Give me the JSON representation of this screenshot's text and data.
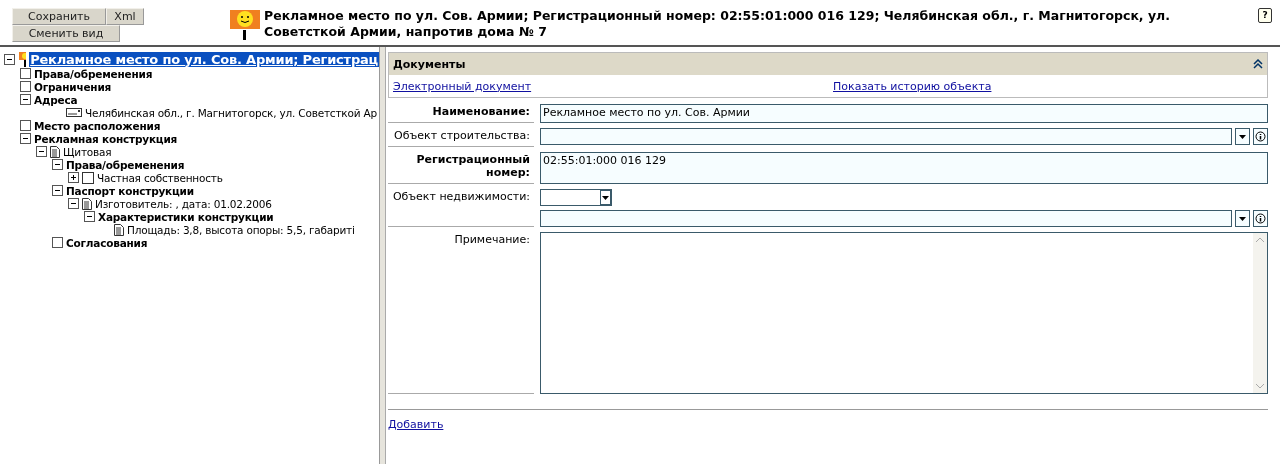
{
  "toolbar": {
    "buttons": [
      {
        "label": "Сохранить"
      },
      {
        "label": "Xml"
      },
      {
        "label": "Сменить вид"
      }
    ]
  },
  "header": {
    "title": "Рекламное место по ул. Сов. Армии; Регистрационный номер: 02:55:01:000 016 129; Челябинская обл., г. Магнитогорск, ул. Советсткой Армии, напротив дома № 7",
    "help": "?"
  },
  "tree": [
    {
      "kind": "root",
      "label": "Рекламное место по ул. Сов. Армии; Регистрац",
      "expanded": true,
      "selected": true,
      "children": [
        {
          "kind": "section",
          "label": "Права/обременения",
          "selected": false
        },
        {
          "kind": "section",
          "label": "Ограничения",
          "selected": false
        },
        {
          "kind": "section",
          "label": "Адреса",
          "expanded": true,
          "selected": false,
          "children": [
            {
              "kind": "address",
              "label": "Челябинская обл., г. Магнитогорск, ул. Советсткой Ар",
              "selected": false
            }
          ]
        },
        {
          "kind": "section",
          "label": "Место расположения",
          "selected": false
        },
        {
          "kind": "section",
          "label": "Рекламная конструкция",
          "expanded": true,
          "selected": false,
          "children": [
            {
              "kind": "document",
              "label": "Щитовая",
              "expanded": true,
              "selected": false,
              "children": [
                {
                  "kind": "section",
                  "label": "Права/обременения",
                  "expanded": true,
                  "selected": false,
                  "children": [
                    {
                      "kind": "record",
                      "label": "Частная собственность",
                      "expanded": false,
                      "selected": false
                    }
                  ]
                },
                {
                  "kind": "section",
                  "label": "Паспорт конструкции",
                  "expanded": true,
                  "selected": false,
                  "children": [
                    {
                      "kind": "document",
                      "label": "Изготовитель: , дата: 01.02.2006",
                      "expanded": true,
                      "selected": false,
                      "children": [
                        {
                          "kind": "section",
                          "label": "Характеристики конструкции",
                          "expanded": true,
                          "selected": false,
                          "children": [
                            {
                              "kind": "document",
                              "label": "Площадь: 3,8, высота опоры: 5,5, габариті",
                              "selected": false
                            }
                          ]
                        }
                      ]
                    }
                  ]
                },
                {
                  "kind": "section",
                  "label": "Согласования",
                  "selected": false
                }
              ]
            }
          ]
        }
      ]
    }
  ],
  "panel": {
    "title": "Документы",
    "expanded": true,
    "links": [
      "Электронный документ",
      "Показать историю объекта"
    ]
  },
  "form": [
    {
      "kind": "text",
      "label": "Наименование:",
      "required": true,
      "value": "Рекламное место по ул. Сов. Армии"
    },
    {
      "kind": "lookup",
      "label": "Объект строительства:",
      "required": false
    },
    {
      "kind": "text",
      "label": "Регистрационный номер:",
      "required": true,
      "value": "02:55:01:000 016 129"
    },
    {
      "kind": "select-lookup",
      "label": "Объект недвижимости:",
      "required": false
    },
    {
      "kind": "memo",
      "label": "Примечание:",
      "required": false
    }
  ],
  "add_link": "Добавить"
}
